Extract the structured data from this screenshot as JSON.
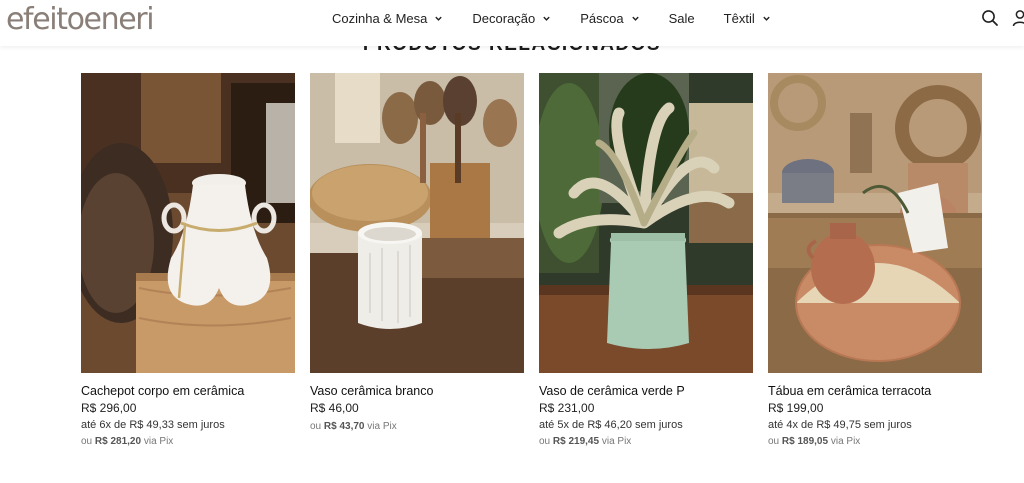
{
  "header": {
    "logo": "efeitoeneri",
    "nav": [
      {
        "label": "Cozinha & Mesa",
        "dropdown": true
      },
      {
        "label": "Decoração",
        "dropdown": true
      },
      {
        "label": "Páscoa",
        "dropdown": true
      },
      {
        "label": "Sale",
        "dropdown": false
      },
      {
        "label": "Têxtil",
        "dropdown": true
      }
    ],
    "icons": [
      "search-icon",
      "user-icon"
    ]
  },
  "section": {
    "title": "PRODUTOS RELACIONADOS"
  },
  "products": [
    {
      "name": "Cachepot corpo em cerâmica",
      "price": "R$ 296,00",
      "installments": "até 6x de R$ 49,33 sem juros",
      "pix_prefix": "ou",
      "pix_price": "R$ 281,20",
      "pix_suffix": "via Pix"
    },
    {
      "name": "Vaso cerâmica branco",
      "price": "R$ 46,00",
      "installments": "",
      "pix_prefix": "ou",
      "pix_price": "R$ 43,70",
      "pix_suffix": "via Pix"
    },
    {
      "name": "Vaso de cerâmica verde P",
      "price": "R$ 231,00",
      "installments": "até 5x de R$ 46,20 sem juros",
      "pix_prefix": "ou",
      "pix_price": "R$ 219,45",
      "pix_suffix": "via Pix"
    },
    {
      "name": "Tábua em cerâmica terracota",
      "price": "R$ 199,00",
      "installments": "até 4x de R$ 49,75 sem juros",
      "pix_prefix": "ou",
      "pix_price": "R$ 189,05",
      "pix_suffix": "via Pix"
    }
  ],
  "colors": {
    "logo": "#8a7f78",
    "text": "#111111",
    "muted": "#777777"
  }
}
